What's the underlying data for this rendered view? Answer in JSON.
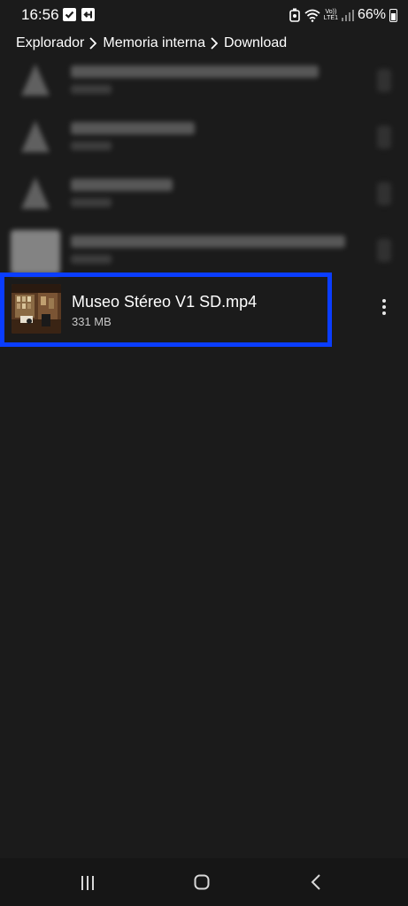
{
  "status_bar": {
    "time": "16:56",
    "battery_percent": "66%",
    "network_label_top": "Vo))",
    "network_label_bottom": "LTE1",
    "icons": [
      "check-box-icon",
      "exit-icon",
      "alarm-icon",
      "wifi-icon",
      "signal-icon",
      "battery-icon"
    ]
  },
  "breadcrumb": {
    "items": [
      "Explorador",
      "Memoria interna",
      "Download"
    ]
  },
  "selected_file": {
    "name": "Museo Stéreo V1 SD.mp4",
    "size": "331 MB",
    "highlight_color": "#0a3dff"
  },
  "nav_bar": {
    "icons": [
      "recents-icon",
      "home-icon",
      "back-icon"
    ]
  }
}
